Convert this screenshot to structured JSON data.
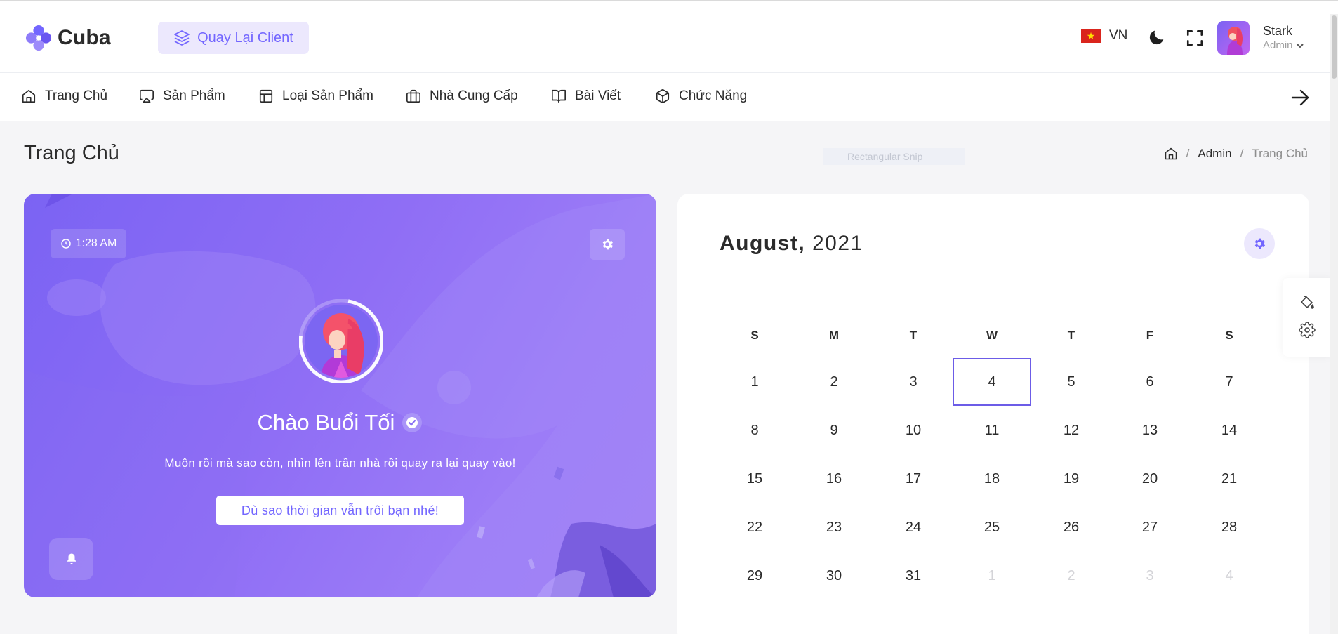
{
  "header": {
    "logo_text": "Cuba",
    "back_button": "Quay Lại Client",
    "language": "VN",
    "user_name": "Stark",
    "user_role": "Admin"
  },
  "nav": {
    "items": [
      {
        "label": "Trang Chủ",
        "icon": "home-icon"
      },
      {
        "label": "Sản Phẩm",
        "icon": "airplay-icon"
      },
      {
        "label": "Loại Sản Phẩm",
        "icon": "layout-icon"
      },
      {
        "label": "Nhà Cung Cấp",
        "icon": "briefcase-icon"
      },
      {
        "label": "Bài Viết",
        "icon": "book-icon"
      },
      {
        "label": "Chức Năng",
        "icon": "box-icon"
      }
    ]
  },
  "page": {
    "title": "Trang Chủ",
    "snip_label": "Rectangular Snip",
    "breadcrumb": {
      "admin": "Admin",
      "current": "Trang Chủ"
    }
  },
  "welcome": {
    "time": "1:28 AM",
    "greeting": "Chào Buổi Tối",
    "subtitle": "Muộn rồi mà sao còn, nhìn lên trần nhà rồi quay ra lại quay vào!",
    "cta": "Dù sao thời gian vẫn trôi bạn nhé!"
  },
  "calendar": {
    "month": "August,",
    "year": "2021",
    "weekdays": [
      "S",
      "M",
      "T",
      "W",
      "T",
      "F",
      "S"
    ],
    "weeks": [
      [
        "1",
        "2",
        "3",
        "4",
        "5",
        "6",
        "7"
      ],
      [
        "8",
        "9",
        "10",
        "11",
        "12",
        "13",
        "14"
      ],
      [
        "15",
        "16",
        "17",
        "18",
        "19",
        "20",
        "21"
      ],
      [
        "22",
        "23",
        "24",
        "25",
        "26",
        "27",
        "28"
      ],
      [
        "29",
        "30",
        "31",
        "1",
        "2",
        "3",
        "4"
      ]
    ],
    "today": "4"
  },
  "colors": {
    "primary": "#7366ff",
    "primary_light": "#ece8fd",
    "text": "#2b2b2b"
  }
}
